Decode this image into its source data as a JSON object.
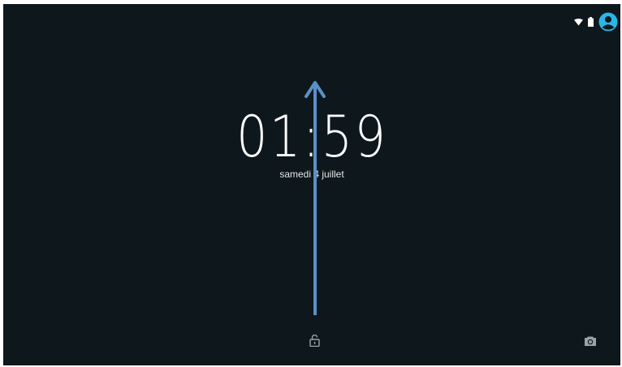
{
  "lock_screen": {
    "time": "01:59",
    "date": "samedi 4 juillet"
  },
  "status_bar": {
    "icons": [
      "wifi-icon",
      "battery-icon",
      "user-avatar-icon"
    ]
  },
  "bottom_bar": {
    "left_icon": "unlock-icon",
    "right_icon": "camera-icon"
  },
  "annotation": {
    "type": "swipe-up-arrow",
    "color": "#5b8fc7"
  },
  "colors": {
    "background": "#0e171c",
    "accent": "#2ab6e6",
    "text": "#ffffff"
  }
}
